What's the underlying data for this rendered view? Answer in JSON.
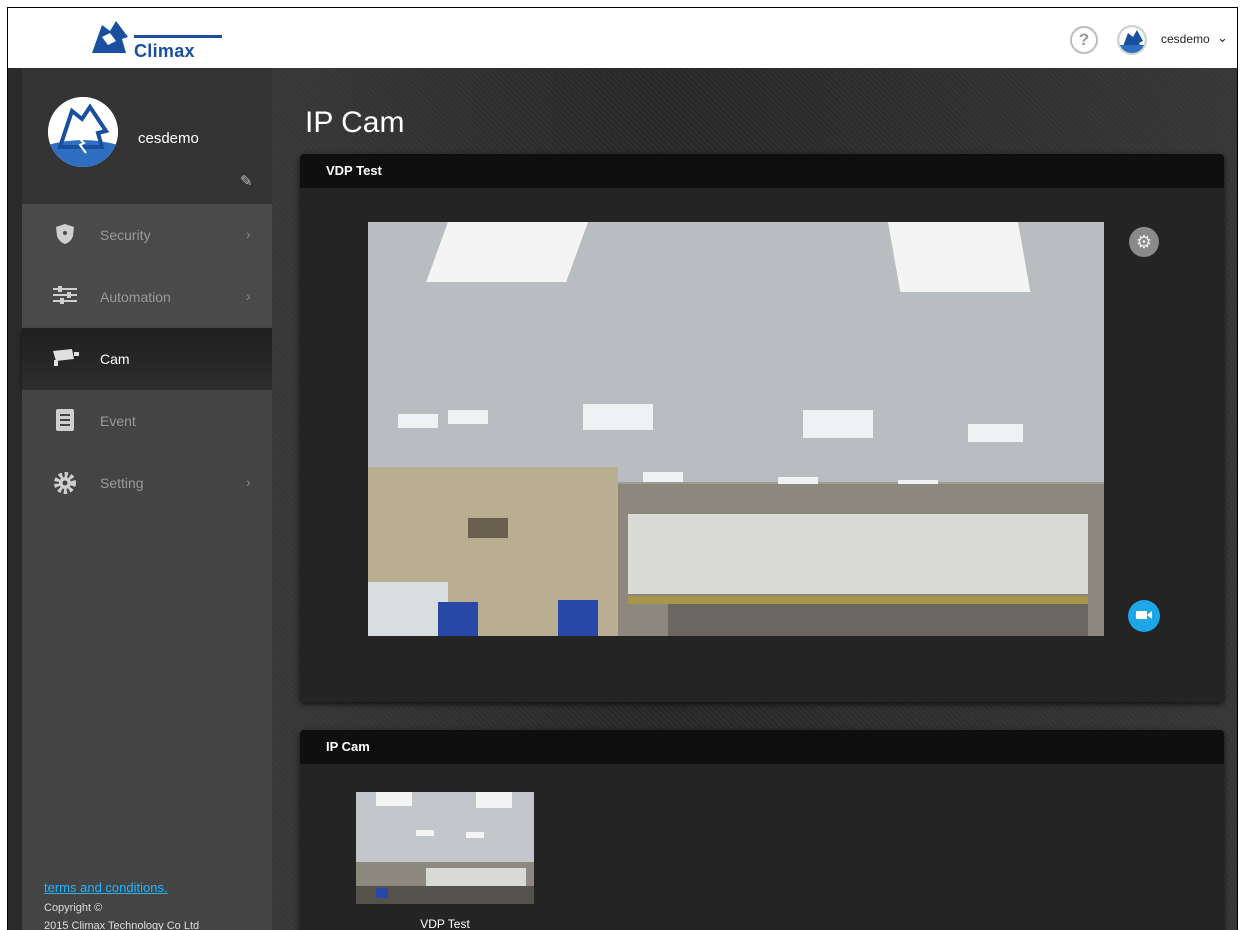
{
  "brand": {
    "logo_text": "Climax"
  },
  "topbar": {
    "help_label": "?",
    "username": "cesdemo",
    "caret": "⌄"
  },
  "profile": {
    "name": "cesdemo"
  },
  "sidebar": {
    "items": [
      {
        "label": "Security",
        "icon": "shield-icon",
        "chevron": "›"
      },
      {
        "label": "Automation",
        "icon": "sliders-icon",
        "chevron": "›"
      },
      {
        "label": "Cam",
        "icon": "camera-icon",
        "chevron": ""
      },
      {
        "label": "Event",
        "icon": "list-icon",
        "chevron": ""
      },
      {
        "label": "Setting",
        "icon": "gear-icon",
        "chevron": "›"
      }
    ]
  },
  "footer": {
    "terms": "terms and conditions.",
    "copyright": "Copyright ©",
    "company": "2015 Climax Technology Co Ltd"
  },
  "main": {
    "title": "IP Cam",
    "live_panel": {
      "title": "VDP Test"
    },
    "list_panel": {
      "title": "IP Cam",
      "cameras": [
        {
          "name": "VDP Test"
        }
      ]
    }
  },
  "colors": {
    "brand_blue": "#1a4fa0",
    "accent_cyan": "#1ea6e8",
    "link": "#22b4ff",
    "sidebar_bg": "#444444",
    "panel_head": "#0f0f0f"
  }
}
